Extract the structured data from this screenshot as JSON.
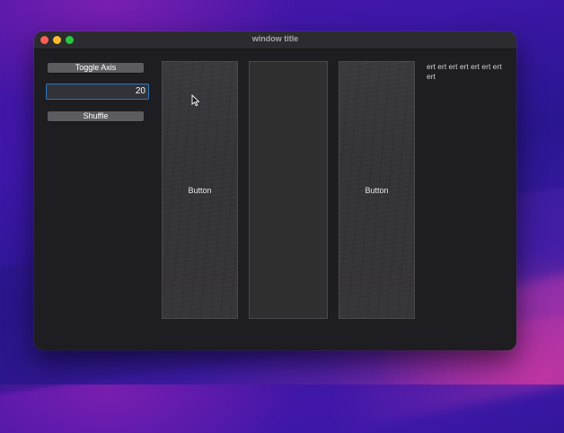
{
  "window": {
    "title": "window title"
  },
  "sidebar": {
    "toggle_axis_label": "Toggle Axis",
    "number_value": "20",
    "shuffle_label": "Shuffle"
  },
  "panels": [
    {
      "label": "Button"
    },
    {
      "label": ""
    },
    {
      "label": "Button"
    }
  ],
  "side_text": "ert ert ert ert ert ert ert ert",
  "colors": {
    "window_bg": "#1e1d21",
    "button_bg": "#5d5c61",
    "focus_ring": "#2a78c7",
    "close": "#fe5f57",
    "minimize": "#febc2e",
    "maximize": "#28c840"
  }
}
